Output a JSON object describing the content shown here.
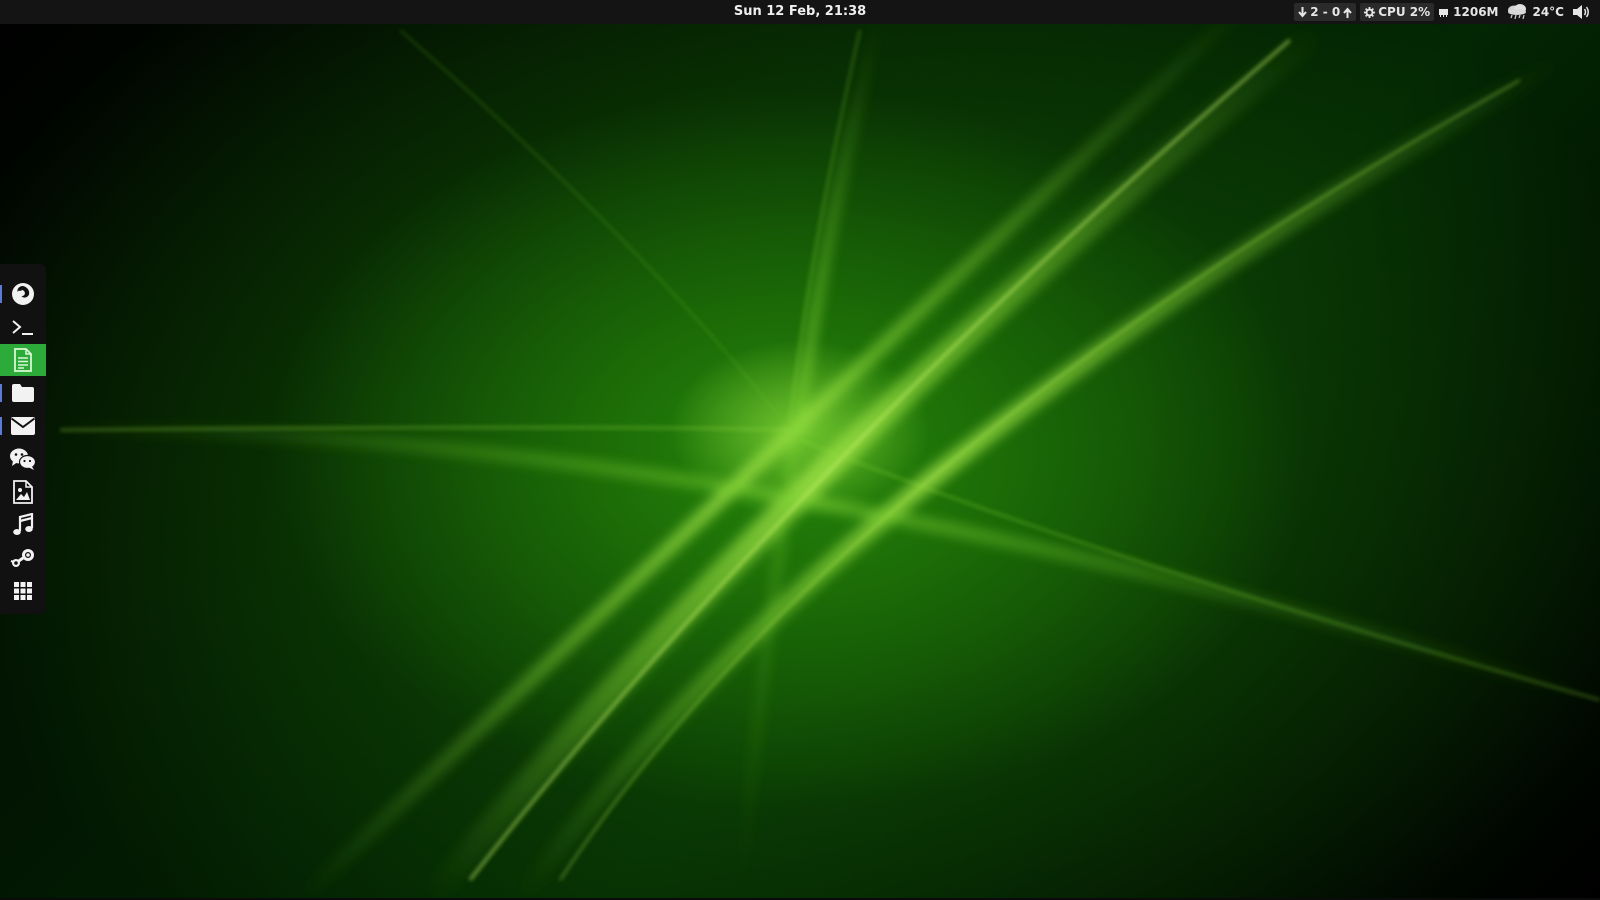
{
  "topbar": {
    "clock": "Sun 12 Feb, 21:38",
    "updates_text": "2 - 0",
    "cpu_text": "CPU 2%",
    "memory_text": "1206M",
    "temperature_text": "24°C"
  },
  "dock": {
    "items": [
      {
        "name": "firefox",
        "icon": "firefox-icon",
        "running": true
      },
      {
        "name": "terminal",
        "icon": "terminal-icon",
        "running": false
      },
      {
        "name": "text-editor",
        "icon": "text-editor-icon",
        "running": false,
        "active": true
      },
      {
        "name": "files",
        "icon": "folder-icon",
        "running": true
      },
      {
        "name": "mail",
        "icon": "mail-icon",
        "running": true
      },
      {
        "name": "wechat",
        "icon": "wechat-icon",
        "running": false
      },
      {
        "name": "image-viewer",
        "icon": "image-viewer-icon",
        "running": false
      },
      {
        "name": "music",
        "icon": "music-icon",
        "running": false
      },
      {
        "name": "steam",
        "icon": "steam-icon",
        "running": false
      },
      {
        "name": "app-grid",
        "icon": "app-grid-icon",
        "running": false
      }
    ]
  },
  "colors": {
    "accent": "#2dab3a",
    "running_indicator": "#5a7bd6",
    "panel": "#141414"
  }
}
